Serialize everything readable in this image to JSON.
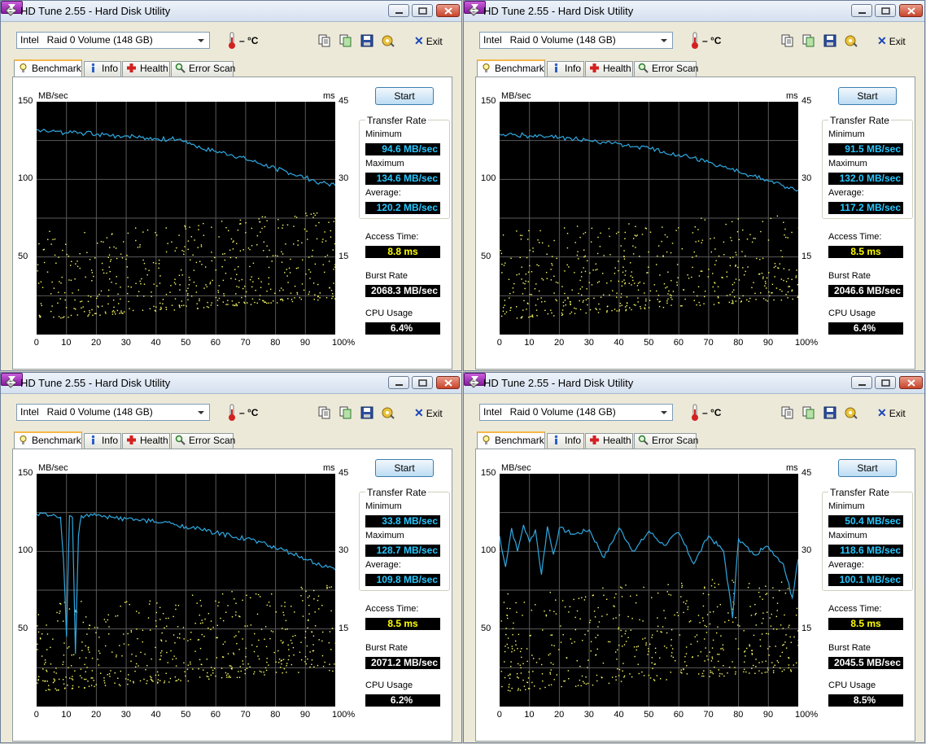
{
  "windows": [
    {
      "title": "HD Tune 2.55 - Hard Disk Utility",
      "drive": "Intel   Raid 0 Volume (148 GB)",
      "temperature": "– °C",
      "exit_label": "Exit",
      "tabs": [
        "Benchmark",
        "Info",
        "Health",
        "Error Scan"
      ],
      "start_label": "Start",
      "y_unit": "MB/sec",
      "y2_unit": "ms",
      "y_ticks": [
        "150",
        "100",
        "50"
      ],
      "y2_ticks": [
        "45",
        "30",
        "15"
      ],
      "x_ticks": [
        "0",
        "10",
        "20",
        "30",
        "40",
        "50",
        "60",
        "70",
        "80",
        "90",
        "100%"
      ],
      "transfer_rate_label": "Transfer Rate",
      "minimum_label": "Minimum",
      "minimum": "94.6 MB/sec",
      "maximum_label": "Maximum",
      "maximum": "134.6 MB/sec",
      "average_label": "Average:",
      "average": "120.2 MB/sec",
      "access_time_label": "Access Time:",
      "access_time": "8.8 ms",
      "burst_rate_label": "Burst Rate",
      "burst_rate": "2068.3 MB/sec",
      "cpu_usage_label": "CPU Usage",
      "cpu_usage": "6.4%"
    },
    {
      "title": "HD Tune 2.55 - Hard Disk Utility",
      "drive": "Intel   Raid 0 Volume (148 GB)",
      "temperature": "– °C",
      "exit_label": "Exit",
      "tabs": [
        "Benchmark",
        "Info",
        "Health",
        "Error Scan"
      ],
      "start_label": "Start",
      "y_unit": "MB/sec",
      "y2_unit": "ms",
      "y_ticks": [
        "150",
        "100",
        "50"
      ],
      "y2_ticks": [
        "45",
        "30",
        "15"
      ],
      "x_ticks": [
        "0",
        "10",
        "20",
        "30",
        "40",
        "50",
        "60",
        "70",
        "80",
        "90",
        "100%"
      ],
      "transfer_rate_label": "Transfer Rate",
      "minimum_label": "Minimum",
      "minimum": "91.5 MB/sec",
      "maximum_label": "Maximum",
      "maximum": "132.0 MB/sec",
      "average_label": "Average:",
      "average": "117.2 MB/sec",
      "access_time_label": "Access Time:",
      "access_time": "8.5 ms",
      "burst_rate_label": "Burst Rate",
      "burst_rate": "2046.6 MB/sec",
      "cpu_usage_label": "CPU Usage",
      "cpu_usage": "6.4%"
    },
    {
      "title": "HD Tune 2.55 - Hard Disk Utility",
      "drive": "Intel   Raid 0 Volume (148 GB)",
      "temperature": "– °C",
      "exit_label": "Exit",
      "tabs": [
        "Benchmark",
        "Info",
        "Health",
        "Error Scan"
      ],
      "start_label": "Start",
      "y_unit": "MB/sec",
      "y2_unit": "ms",
      "y_ticks": [
        "150",
        "100",
        "50"
      ],
      "y2_ticks": [
        "45",
        "30",
        "15"
      ],
      "x_ticks": [
        "0",
        "10",
        "20",
        "30",
        "40",
        "50",
        "60",
        "70",
        "80",
        "90",
        "100%"
      ],
      "transfer_rate_label": "Transfer Rate",
      "minimum_label": "Minimum",
      "minimum": "33.8 MB/sec",
      "maximum_label": "Maximum",
      "maximum": "128.7 MB/sec",
      "average_label": "Average:",
      "average": "109.8 MB/sec",
      "access_time_label": "Access Time:",
      "access_time": "8.5 ms",
      "burst_rate_label": "Burst Rate",
      "burst_rate": "2071.2 MB/sec",
      "cpu_usage_label": "CPU Usage",
      "cpu_usage": "6.2%"
    },
    {
      "title": "HD Tune 2.55 - Hard Disk Utility",
      "drive": "Intel   Raid 0 Volume (148 GB)",
      "temperature": "– °C",
      "exit_label": "Exit",
      "tabs": [
        "Benchmark",
        "Info",
        "Health",
        "Error Scan"
      ],
      "start_label": "Start",
      "y_unit": "MB/sec",
      "y2_unit": "ms",
      "y_ticks": [
        "150",
        "100",
        "50"
      ],
      "y2_ticks": [
        "45",
        "30",
        "15"
      ],
      "x_ticks": [
        "0",
        "10",
        "20",
        "30",
        "40",
        "50",
        "60",
        "70",
        "80",
        "90",
        "100%"
      ],
      "transfer_rate_label": "Transfer Rate",
      "minimum_label": "Minimum",
      "minimum": "50.4 MB/sec",
      "maximum_label": "Maximum",
      "maximum": "118.6 MB/sec",
      "average_label": "Average:",
      "average": "100.1 MB/sec",
      "access_time_label": "Access Time:",
      "access_time": "8.5 ms",
      "burst_rate_label": "Burst Rate",
      "burst_rate": "2045.5 MB/sec",
      "cpu_usage_label": "CPU Usage",
      "cpu_usage": "8.5%"
    }
  ],
  "colors": {
    "transfer_line": "#2fa8e0",
    "access_dots": "#ffff66",
    "grid": "#5a5a5a",
    "min_max_avg_text": "#26c7ff",
    "access_text": "#ffff00"
  },
  "chart_data": [
    {
      "type": "line",
      "xlabel": "",
      "ylabel": "MB/sec",
      "y2label": "ms",
      "xlim": [
        0,
        100
      ],
      "ylim": [
        0,
        150
      ],
      "y2lim": [
        0,
        45
      ],
      "grid": true,
      "series": [
        {
          "x": [
            0,
            5,
            10,
            15,
            20,
            25,
            30,
            35,
            40,
            45,
            50,
            55,
            60,
            65,
            70,
            75,
            80,
            85,
            90,
            95,
            100
          ],
          "y": [
            132,
            131,
            130,
            130,
            129,
            128,
            128,
            127,
            126,
            126,
            125,
            120,
            118,
            116,
            113,
            110,
            107,
            104,
            101,
            98,
            96
          ]
        }
      ],
      "scatter": {
        "y_axis": "ms",
        "x_range": [
          0,
          100
        ],
        "y_range_ms": [
          3,
          20
        ]
      }
    },
    {
      "type": "line",
      "xlabel": "",
      "ylabel": "MB/sec",
      "y2label": "ms",
      "xlim": [
        0,
        100
      ],
      "ylim": [
        0,
        150
      ],
      "y2lim": [
        0,
        45
      ],
      "grid": true,
      "series": [
        {
          "x": [
            0,
            5,
            10,
            15,
            20,
            25,
            30,
            35,
            40,
            45,
            50,
            55,
            60,
            65,
            70,
            75,
            80,
            85,
            90,
            95,
            100
          ],
          "y": [
            129,
            129,
            128,
            127,
            127,
            126,
            125,
            124,
            123,
            121,
            120,
            118,
            116,
            114,
            111,
            108,
            105,
            102,
            99,
            96,
            93
          ]
        }
      ],
      "scatter": {
        "y_axis": "ms",
        "x_range": [
          0,
          100
        ],
        "y_range_ms": [
          3,
          20
        ]
      }
    },
    {
      "type": "line",
      "xlabel": "",
      "ylabel": "MB/sec",
      "y2label": "ms",
      "xlim": [
        0,
        100
      ],
      "ylim": [
        0,
        150
      ],
      "y2lim": [
        0,
        45
      ],
      "grid": true,
      "series": [
        {
          "x": [
            0,
            5,
            8,
            9,
            10,
            11,
            12,
            13,
            14,
            15,
            20,
            25,
            30,
            35,
            40,
            45,
            50,
            55,
            60,
            65,
            70,
            75,
            80,
            85,
            90,
            95,
            100
          ],
          "y": [
            124,
            123,
            122,
            95,
            45,
            123,
            122,
            34,
            110,
            123,
            123,
            122,
            121,
            120,
            119,
            118,
            116,
            114,
            112,
            110,
            108,
            106,
            102,
            99,
            95,
            91,
            88
          ]
        }
      ],
      "scatter": {
        "y_axis": "ms",
        "x_range": [
          0,
          100
        ],
        "y_range_ms": [
          3,
          20
        ]
      }
    },
    {
      "type": "line",
      "xlabel": "",
      "ylabel": "MB/sec",
      "y2label": "ms",
      "xlim": [
        0,
        100
      ],
      "ylim": [
        0,
        150
      ],
      "y2lim": [
        0,
        45
      ],
      "grid": true,
      "series": [
        {
          "x": [
            0,
            2,
            4,
            6,
            8,
            10,
            12,
            14,
            16,
            18,
            20,
            25,
            30,
            35,
            40,
            45,
            50,
            55,
            60,
            65,
            70,
            75,
            78,
            80,
            85,
            90,
            95,
            98,
            100
          ],
          "y": [
            110,
            90,
            115,
            100,
            117,
            106,
            114,
            85,
            116,
            98,
            115,
            111,
            114,
            96,
            115,
            100,
            113,
            104,
            112,
            92,
            110,
            100,
            57,
            108,
            98,
            103,
            92,
            70,
            95
          ]
        }
      ],
      "scatter": {
        "y_axis": "ms",
        "x_range": [
          0,
          100
        ],
        "y_range_ms": [
          3,
          22
        ]
      }
    }
  ]
}
